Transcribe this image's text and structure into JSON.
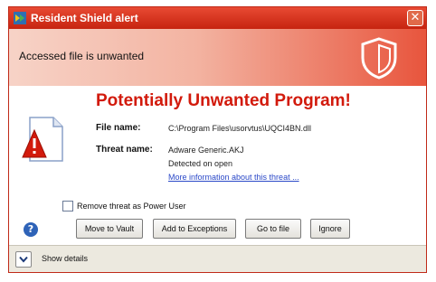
{
  "window": {
    "title": "Resident Shield alert",
    "close_glyph": "✕"
  },
  "banner": {
    "text": "Accessed file is unwanted",
    "icon": "shield-icon"
  },
  "alert": {
    "headline": "Potentially Unwanted Program!",
    "icon": "warning-document-icon",
    "file_label": "File name:",
    "file_value": "C:\\Program Files\\usorvtus\\UQCI4BN.dll",
    "threat_label": "Threat name:",
    "threat_value": "Adware Generic.AKJ",
    "detected_text": "Detected on open",
    "more_info_link": "More information about this threat ..."
  },
  "options": {
    "remove_as_power_user": "Remove threat as Power User",
    "remove_checked": false
  },
  "buttons": {
    "help": "?",
    "move_to_vault": "Move to Vault",
    "add_to_exceptions": "Add to Exceptions",
    "go_to_file": "Go to file",
    "ignore": "Ignore"
  },
  "footer": {
    "show_details": "Show details"
  },
  "colors": {
    "accent_red": "#d21a0c",
    "titlebar_red": "#c62410",
    "link_blue": "#2a48c8"
  }
}
